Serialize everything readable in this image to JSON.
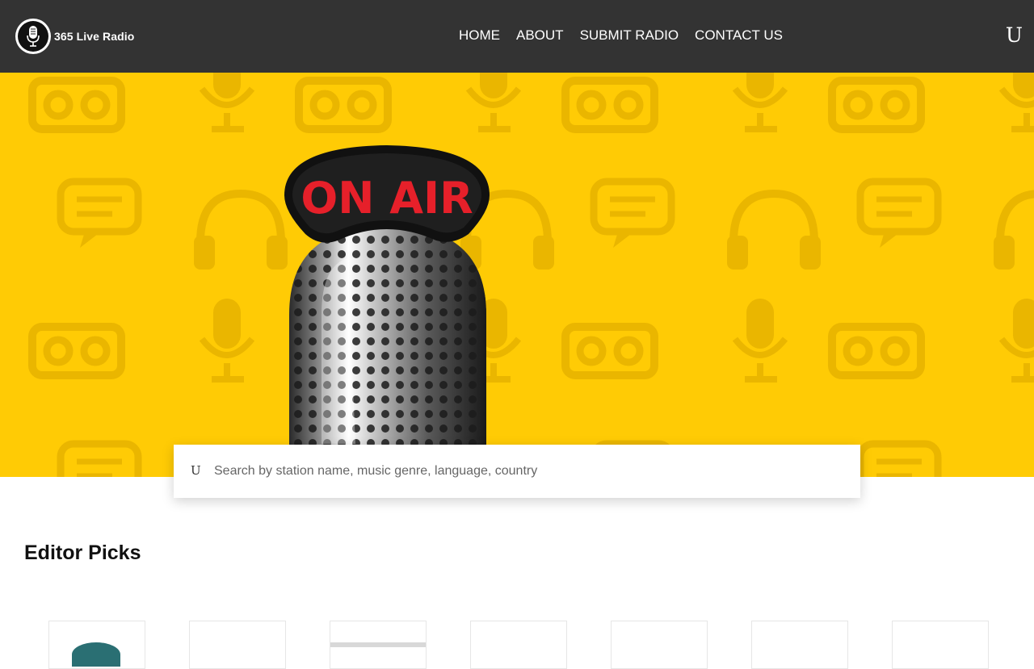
{
  "header": {
    "logo_text": "365 Live Radio",
    "nav": [
      "HOME",
      "ABOUT",
      "SUBMIT RADIO",
      "CONTACT US"
    ],
    "user_glyph": "U"
  },
  "hero": {
    "sign_text": "ON AIR"
  },
  "search": {
    "glyph": "U",
    "placeholder": "Search by station name, music genre, language, country"
  },
  "editor_picks": {
    "title": "Editor Picks",
    "cards": [
      "station-1",
      "station-2",
      "station-3",
      "station-4",
      "station-5",
      "station-6",
      "station-7"
    ]
  },
  "colors": {
    "header_bg": "#333333",
    "hero_bg": "#ffcb05",
    "sign_red": "#e6202a"
  }
}
